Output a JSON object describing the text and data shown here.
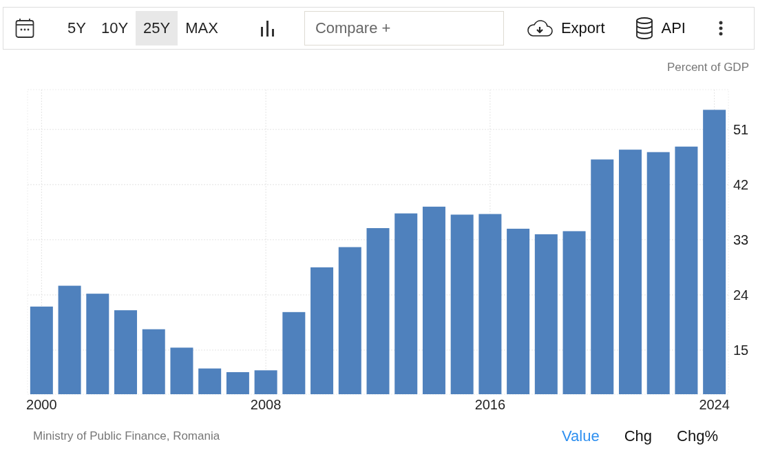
{
  "toolbar": {
    "ranges": [
      {
        "label": "5Y",
        "selected": false
      },
      {
        "label": "10Y",
        "selected": false
      },
      {
        "label": "25Y",
        "selected": true
      },
      {
        "label": "MAX",
        "selected": false
      }
    ],
    "compare": {
      "placeholder": "Compare +"
    },
    "actions": [
      {
        "kind": "export",
        "label": "Export"
      },
      {
        "kind": "api",
        "label": "API"
      }
    ]
  },
  "chart": {
    "chart_data": {
      "type": "bar",
      "x": [
        2000,
        2001,
        2002,
        2003,
        2004,
        2005,
        2006,
        2007,
        2008,
        2009,
        2010,
        2011,
        2012,
        2013,
        2014,
        2015,
        2016,
        2017,
        2018,
        2019,
        2020,
        2021,
        2022,
        2023,
        2024
      ],
      "grid": true,
      "xlim": [
        1999.5,
        2024.5
      ],
      "ylabel": "Percent of GDP",
      "series": [
        {
          "color": "#4f81bd",
          "values": [
            22.1,
            25.5,
            24.2,
            21.5,
            18.4,
            15.4,
            12.0,
            11.4,
            11.7,
            21.2,
            28.5,
            31.8,
            34.9,
            37.3,
            38.4,
            37.1,
            37.2,
            34.8,
            33.9,
            34.4,
            46.1,
            47.7,
            47.3,
            48.2,
            54.2
          ]
        }
      ],
      "ylim": [
        7.8,
        57.5
      ],
      "yticks": [
        15,
        24,
        33,
        42,
        51
      ],
      "xticks": [
        2000,
        2008,
        2016,
        2024
      ]
    }
  },
  "footer": {
    "source": "Ministry of Public Finance, Romania",
    "views": [
      {
        "label": "Value",
        "selected": true
      },
      {
        "label": "Chg",
        "selected": false
      },
      {
        "label": "Chg%",
        "selected": false
      }
    ]
  }
}
